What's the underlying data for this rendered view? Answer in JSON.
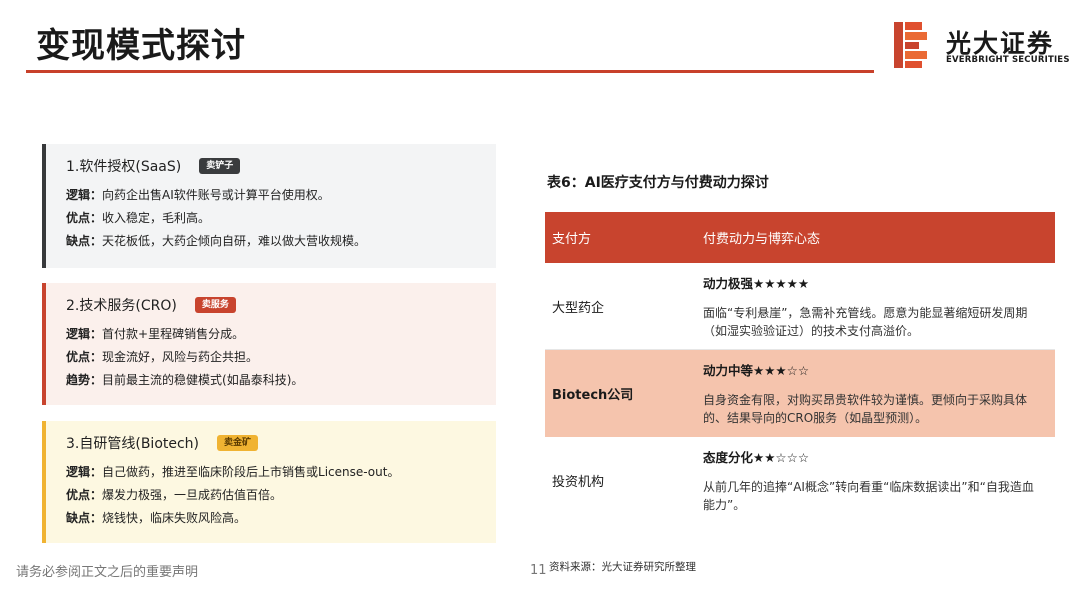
{
  "slide": {
    "title": "变现模式探讨"
  },
  "logo": {
    "cn": "光大证券",
    "en": "EVERBRIGHT SECURITIES"
  },
  "colors": {
    "accent": "#c8442e",
    "dark": "#37393b",
    "gold": "#f0b332",
    "highlight_row": "#f5c4ad"
  },
  "cards": [
    {
      "title": "1.软件授权(SaaS)",
      "tag": "卖铲子",
      "lines": [
        {
          "label": "逻辑：",
          "text": "向药企出售AI软件账号或计算平台使用权。"
        },
        {
          "label": "优点：",
          "text": "收入稳定，毛利高。"
        },
        {
          "label": "缺点：",
          "text": "天花板低，大药企倾向自研，难以做大营收规模。"
        }
      ]
    },
    {
      "title": "2.技术服务(CRO)",
      "tag": "卖服务",
      "lines": [
        {
          "label": "逻辑：",
          "text": "首付款+里程碑销售分成。"
        },
        {
          "label": "优点：",
          "text": "现金流好，风险与药企共担。"
        },
        {
          "label": "趋势：",
          "text": "目前最主流的稳健模式(如晶泰科技)。"
        }
      ]
    },
    {
      "title": "3.自研管线(Biotech)",
      "tag": "卖金矿",
      "lines": [
        {
          "label": "逻辑：",
          "text": "自己做药，推进至临床阶段后上市销售或License-out。"
        },
        {
          "label": "优点：",
          "text": "爆发力极强，一旦成药估值百倍。"
        },
        {
          "label": "缺点：",
          "text": "烧钱快，临床失败风险高。"
        }
      ]
    }
  ],
  "table": {
    "caption": "表6：AI医疗支付方与付费动力探讨",
    "headers": [
      "支付方",
      "付费动力与博弈心态"
    ],
    "rows": [
      {
        "payer": "大型药企",
        "rating": "动力极强★★★★★",
        "desc": "面临“专利悬崖”，急需补充管线。愿意为能显著缩短研发周期（如湿实验验证过）的技术支付高溢价。"
      },
      {
        "payer": "Biotech公司",
        "rating": "动力中等★★★☆☆",
        "desc": "自身资金有限，对购买昂贵软件较为谨慎。更倾向于采购具体的、结果导向的CRO服务（如晶型预测）。"
      },
      {
        "payer": "投资机构",
        "rating": "态度分化★★☆☆☆",
        "desc": "从前几年的追捧“AI概念”转向看重“临床数据读出”和“自我造血能力”。"
      }
    ]
  },
  "footer": {
    "disclaimer": "请务必参阅正文之后的重要声明",
    "page": "11",
    "source": "资料来源：光大证券研究所整理"
  }
}
